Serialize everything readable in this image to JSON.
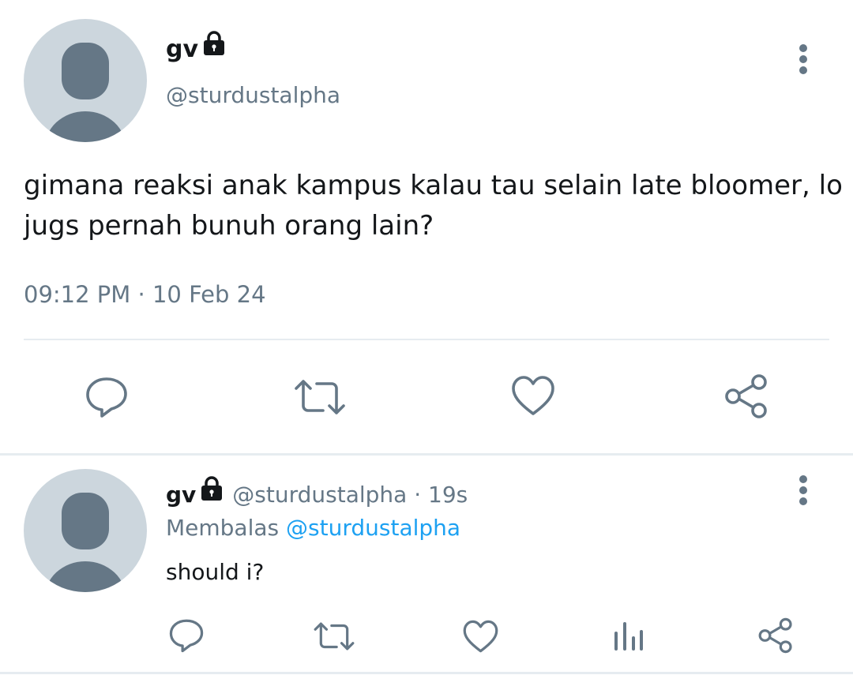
{
  "main_tweet": {
    "display_name": "gv",
    "handle": "@sturdustalpha",
    "text_line1": "gimana reaksi anak kampus kalau tau selain late bloomer, lo",
    "text_line2": "jugs pernah bunuh orang lain?",
    "timestamp": "09:12 PM · 10 Feb 24",
    "actions": [
      "reply-icon",
      "retweet-icon",
      "like-icon",
      "share-icon"
    ]
  },
  "reply_tweet": {
    "display_name": "gv",
    "handle_time": "@sturdustalpha · 19s",
    "replying_prefix": "Membalas",
    "replying_to": "@sturdustalpha",
    "text": "should i?",
    "actions": [
      "reply-icon",
      "retweet-icon",
      "like-icon",
      "analytics-icon",
      "share-icon"
    ]
  },
  "colors": {
    "icon_grey": "#657786",
    "link_blue": "#1da1f2",
    "avatar_bg": "#ccd6dd",
    "divider": "#e6ecf0"
  }
}
